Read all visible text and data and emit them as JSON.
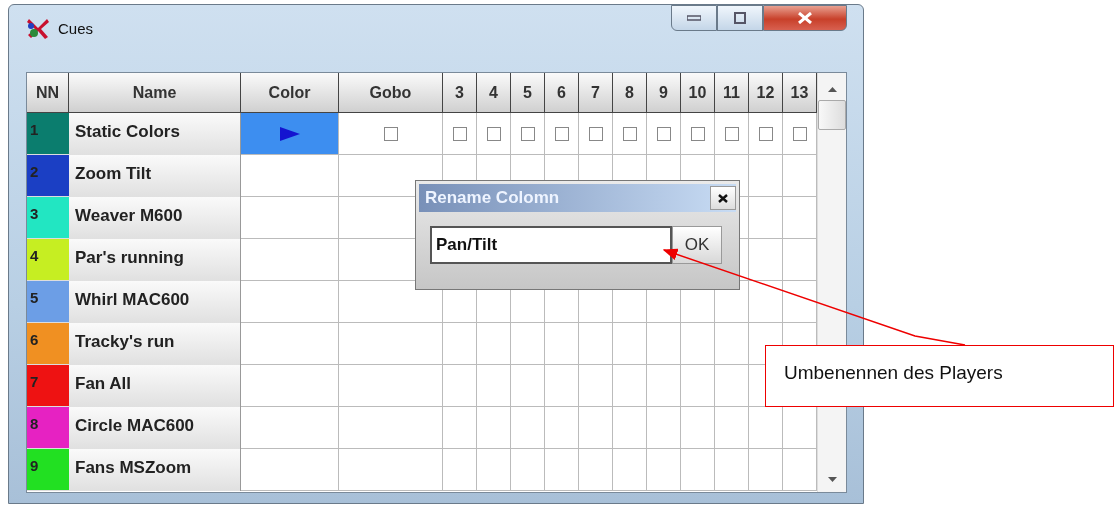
{
  "window": {
    "title": "Cues"
  },
  "table": {
    "columns": [
      {
        "label": "NN"
      },
      {
        "label": "Name"
      },
      {
        "label": "Color"
      },
      {
        "label": "Gobo"
      },
      {
        "label": "3"
      },
      {
        "label": "4"
      },
      {
        "label": "5"
      },
      {
        "label": "6"
      },
      {
        "label": "7"
      },
      {
        "label": "8"
      },
      {
        "label": "9"
      },
      {
        "label": "10"
      },
      {
        "label": "11"
      },
      {
        "label": "12"
      },
      {
        "label": "13"
      }
    ],
    "rows": [
      {
        "nn": "1",
        "name": "Static Colors",
        "color": "#0b7d6e",
        "play": {
          "selected": true
        },
        "checkboxes": [
          {
            "checked": false
          },
          {
            "checked": false
          },
          {
            "checked": false
          },
          {
            "checked": false
          },
          {
            "checked": false
          },
          {
            "checked": false
          },
          {
            "checked": false
          },
          {
            "checked": false
          },
          {
            "checked": false
          },
          {
            "checked": false
          },
          {
            "checked": false
          },
          {
            "checked": false
          }
        ]
      },
      {
        "nn": "2",
        "name": "Zoom Tilt",
        "color": "#1b3fc4"
      },
      {
        "nn": "3",
        "name": "Weaver M600",
        "color": "#22e6c2"
      },
      {
        "nn": "4",
        "name": "Par's running",
        "color": "#c6ee22"
      },
      {
        "nn": "5",
        "name": "Whirl MAC600",
        "color": "#6c9ee6"
      },
      {
        "nn": "6",
        "name": "Tracky's run",
        "color": "#f09022"
      },
      {
        "nn": "7",
        "name": "Fan All",
        "color": "#ee1212"
      },
      {
        "nn": "8",
        "name": "Circle MAC600",
        "color": "#e622c2"
      },
      {
        "nn": "9",
        "name": "Fans MSZoom",
        "color": "#22e022"
      }
    ]
  },
  "dialog": {
    "title": "Rename Colomn",
    "input": {
      "value": "Pan/Tilt"
    },
    "ok_button": "OK"
  },
  "callout": {
    "text": "Umbenennen des Players"
  }
}
